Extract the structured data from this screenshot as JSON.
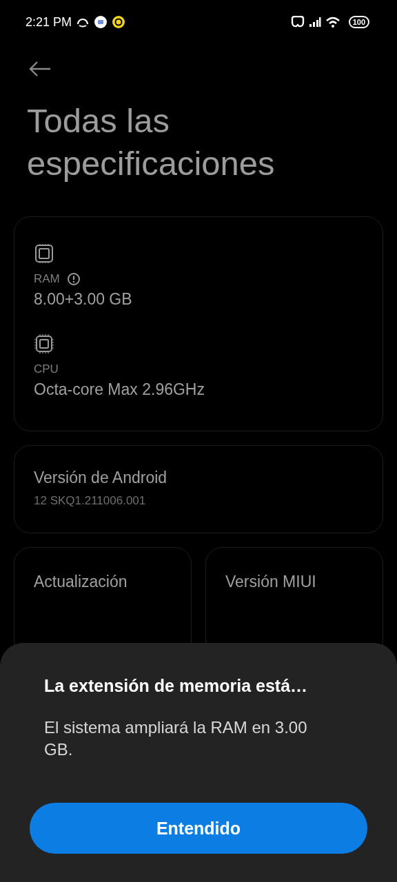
{
  "status_bar": {
    "time": "2:21 PM",
    "battery": "100"
  },
  "title": "Todas las especificaciones",
  "specs_card": {
    "items": [
      {
        "kind": "ram",
        "label": "RAM",
        "info": true,
        "value": "8.00+3.00 GB"
      },
      {
        "kind": "cpu",
        "label": "CPU",
        "info": false,
        "value": "Octa-core Max 2.96GHz"
      }
    ]
  },
  "android_card": {
    "label": "Versión de Android",
    "value": "12 SKQ1.211006.001"
  },
  "half_cards": [
    {
      "label": "Actualización"
    },
    {
      "label": "Versión MIUI"
    }
  ],
  "sheet": {
    "title": "La extensión de memoria está…",
    "message": "El sistema ampliará la RAM en 3.00 GB.",
    "button": "Entendido"
  }
}
